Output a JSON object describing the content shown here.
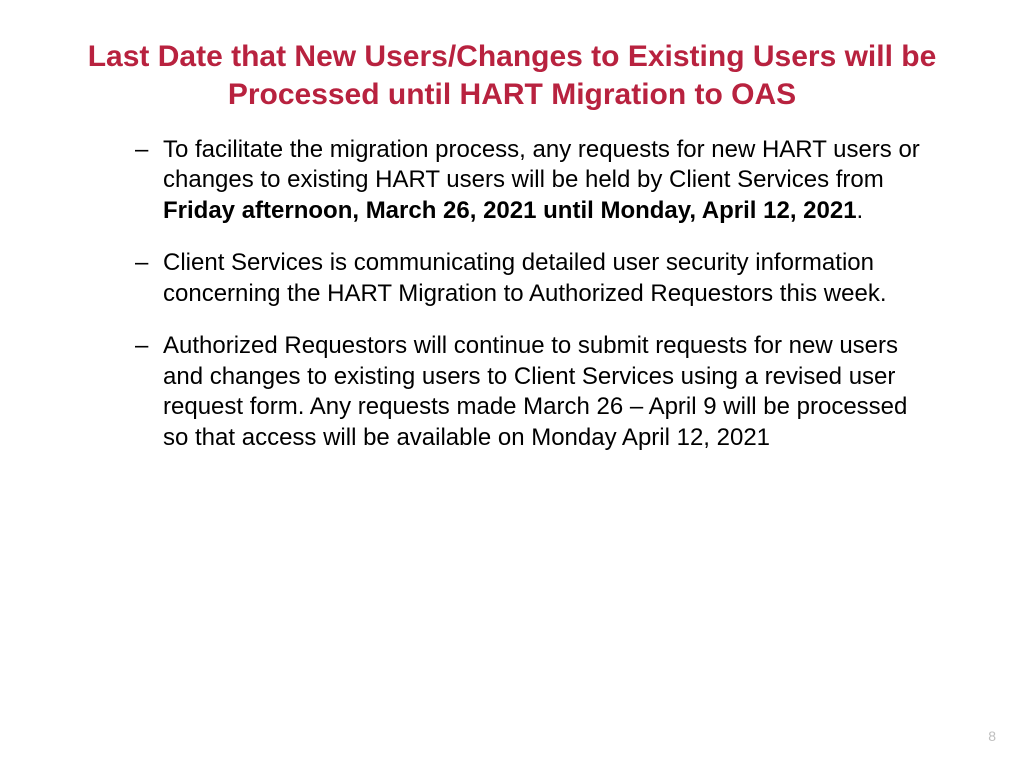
{
  "slide": {
    "title": "Last Date that New Users/Changes to Existing Users will be Processed until HART Migration to OAS",
    "bullets": [
      {
        "pre": "To facilitate the migration process, any requests for new HART users or changes to existing HART users will be held by Client Services from ",
        "bold": "Friday afternoon, March 26, 2021 until Monday, April 12, 2021",
        "post": "."
      },
      {
        "pre": "Client Services is communicating detailed user security information concerning the HART Migration to Authorized Requestors this week.",
        "bold": "",
        "post": ""
      },
      {
        "pre": "Authorized Requestors will continue to submit requests for new users and changes to existing users to Client Services using a revised user request form.  Any requests made March 26 – April 9 will be processed so that access will be available on Monday April 12, 2021",
        "bold": "",
        "post": ""
      }
    ],
    "page_number": "8"
  }
}
